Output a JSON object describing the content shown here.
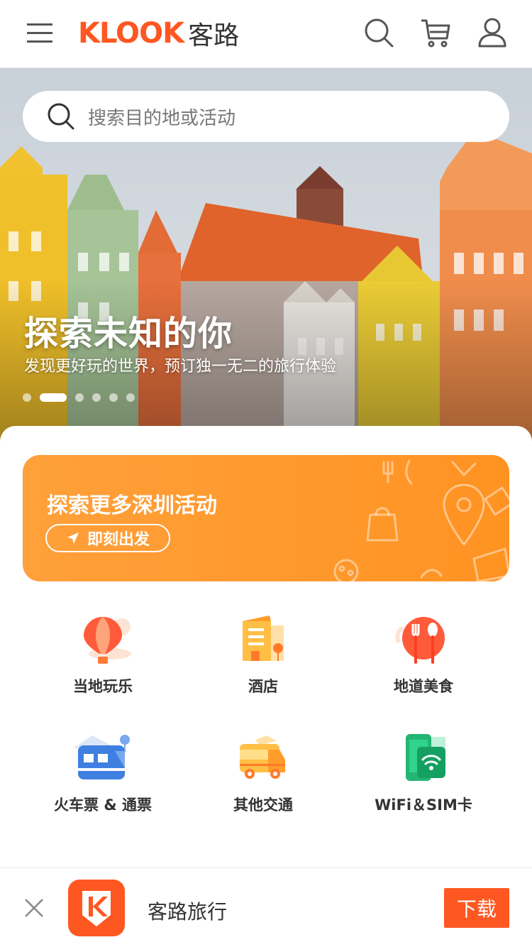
{
  "header": {
    "logo_en": "KLOOK",
    "logo_cn": "客路",
    "brand_color": "#ff5722",
    "icons": [
      "menu-icon",
      "search-icon",
      "cart-icon",
      "user-icon"
    ]
  },
  "hero": {
    "search_placeholder": "搜索目的地或活动",
    "title": "探索未知的你",
    "subtitle": "发现更好玩的世界，预订独一无二的旅行体验",
    "slide_count": 6,
    "active_slide": 2
  },
  "banner": {
    "title": "探索更多深圳活动",
    "button_label": "即刻出发",
    "color": "#ff9a2e"
  },
  "categories": [
    {
      "label": "当地玩乐",
      "icon": "hot-air-balloon-icon"
    },
    {
      "label": "酒店",
      "icon": "hotel-icon"
    },
    {
      "label": "地道美食",
      "icon": "food-icon"
    },
    {
      "label": "火车票 & 通票",
      "icon": "train-icon"
    },
    {
      "label": "其他交通",
      "icon": "bus-icon"
    },
    {
      "label": "WiFi＆SIM卡",
      "icon": "wifi-sim-icon"
    }
  ],
  "bottom_bar": {
    "app_name": "客路旅行",
    "download_label": "下载"
  }
}
